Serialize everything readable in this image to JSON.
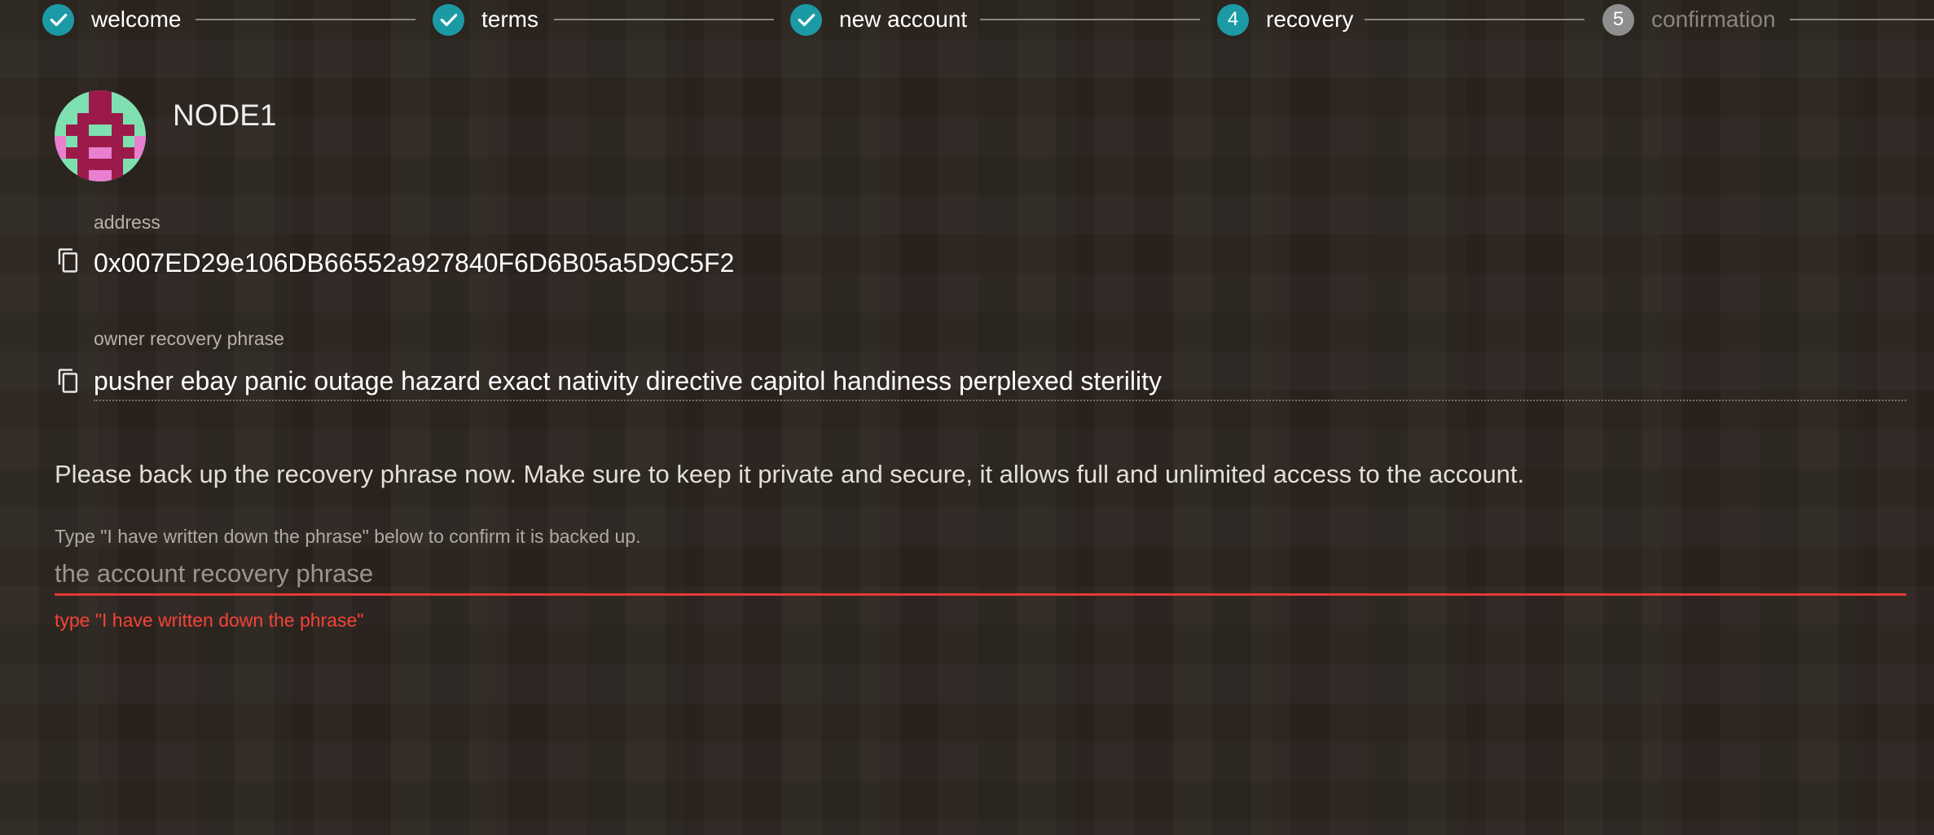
{
  "stepper": {
    "steps": [
      {
        "label": "welcome",
        "status": "done",
        "icon": "check-icon"
      },
      {
        "label": "terms",
        "status": "done",
        "icon": "check-icon"
      },
      {
        "label": "new account",
        "status": "done",
        "icon": "check-icon"
      },
      {
        "label": "recovery",
        "status": "active",
        "number": "4"
      },
      {
        "label": "confirmation",
        "status": "pending",
        "number": "5"
      }
    ]
  },
  "account": {
    "name": "NODE1",
    "avatar_icon": "identicon-avatar",
    "address_label": "address",
    "address": "0x007ED29e106DB66552a927840F6D6B05a5D9C5F2",
    "phrase_label": "owner recovery phrase",
    "phrase": "pusher ebay panic outage hazard exact nativity directive capitol handiness perplexed sterility",
    "copy_icon": "copy-icon"
  },
  "notice": "Please back up the recovery phrase now. Make sure to keep it private and secure, it allows full and unlimited access to the account.",
  "confirm": {
    "label": "Type \"I have written down the phrase\" below to confirm it is backed up.",
    "placeholder": "the account recovery phrase",
    "value": "",
    "error": "type \"I have written down the phrase\""
  },
  "colors": {
    "accent": "#1b9aa6",
    "pending": "#8f8f8f",
    "error": "#e53935",
    "background": "#2b241f"
  }
}
